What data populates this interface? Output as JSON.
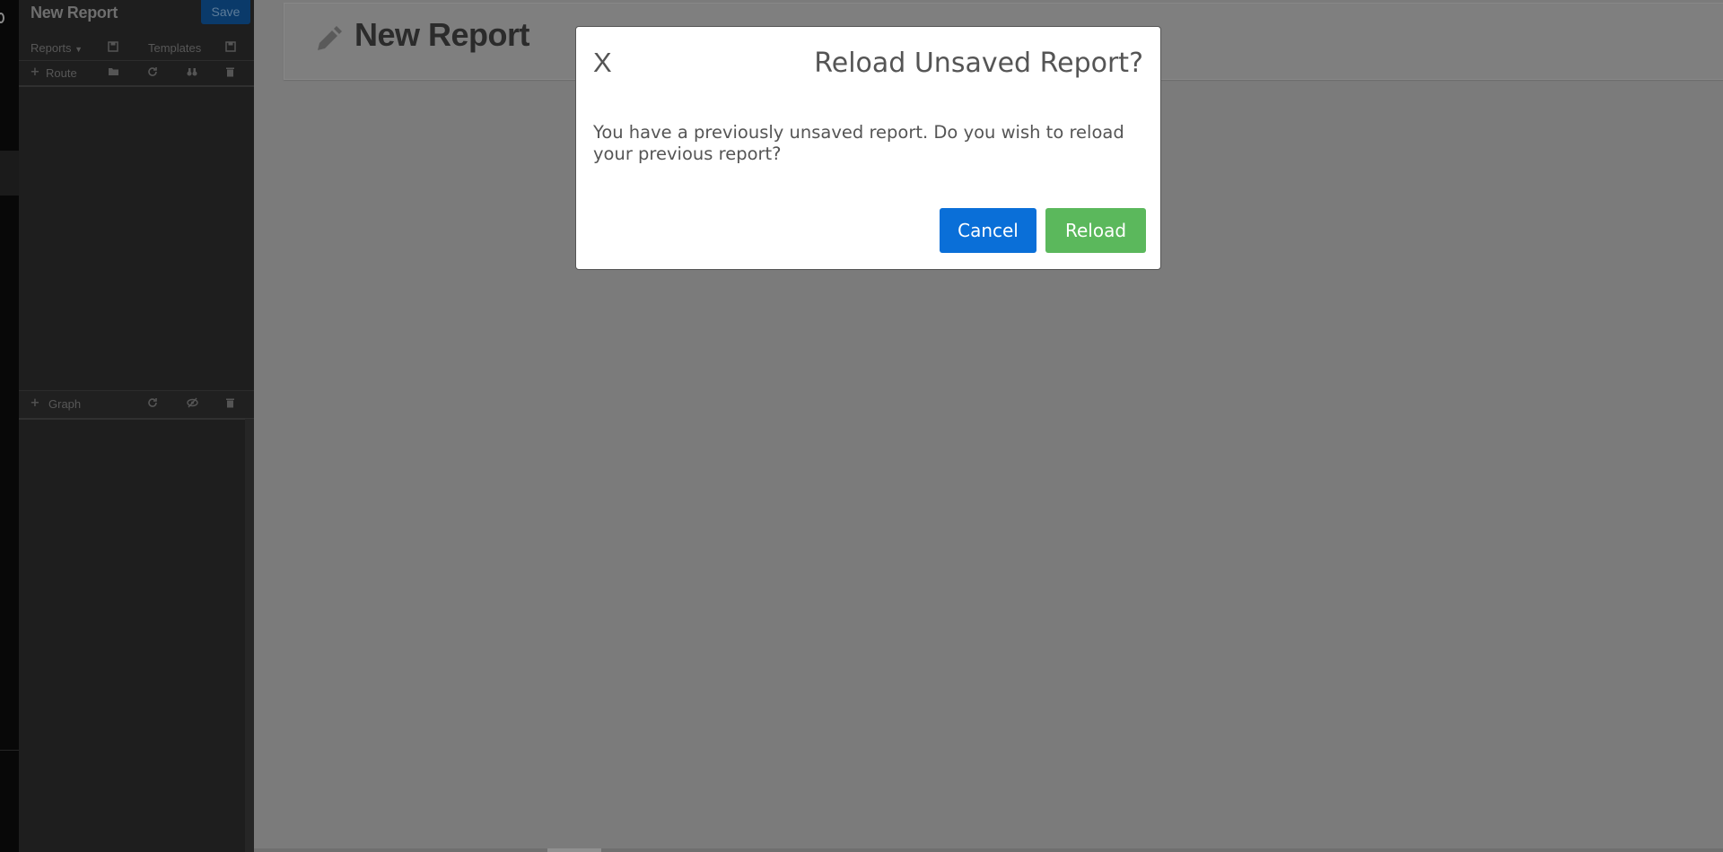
{
  "sidebar": {
    "title": "New Report",
    "save_label": "Save",
    "reports_menu_label": "Reports",
    "templates_label": "Templates",
    "route_label": "Route",
    "graph_label": "Graph"
  },
  "header": {
    "title": "New Report"
  },
  "modal": {
    "close_label": "X",
    "title": "Reload Unsaved Report?",
    "message": "You have a previously unsaved report. Do you wish to reload your previous report?",
    "cancel_label": "Cancel",
    "reload_label": "Reload"
  },
  "colors": {
    "overlay": "#7b7b7b",
    "sidebar": "#1e1e1e",
    "cancel_button": "#0a6fd8",
    "reload_button": "#5bb85c"
  },
  "icons": {
    "reports_save": "floppy-disk-icon",
    "templates_save": "floppy-disk-icon",
    "route_add": "plus-icon",
    "route_open": "folder-open-icon",
    "route_refresh": "refresh-icon",
    "route_binoculars": "binoculars-icon",
    "route_delete": "trash-icon",
    "graph_add": "plus-icon",
    "graph_refresh": "refresh-icon",
    "graph_hide": "eye-slash-icon",
    "graph_delete": "trash-icon",
    "header": "pencil-icon"
  }
}
